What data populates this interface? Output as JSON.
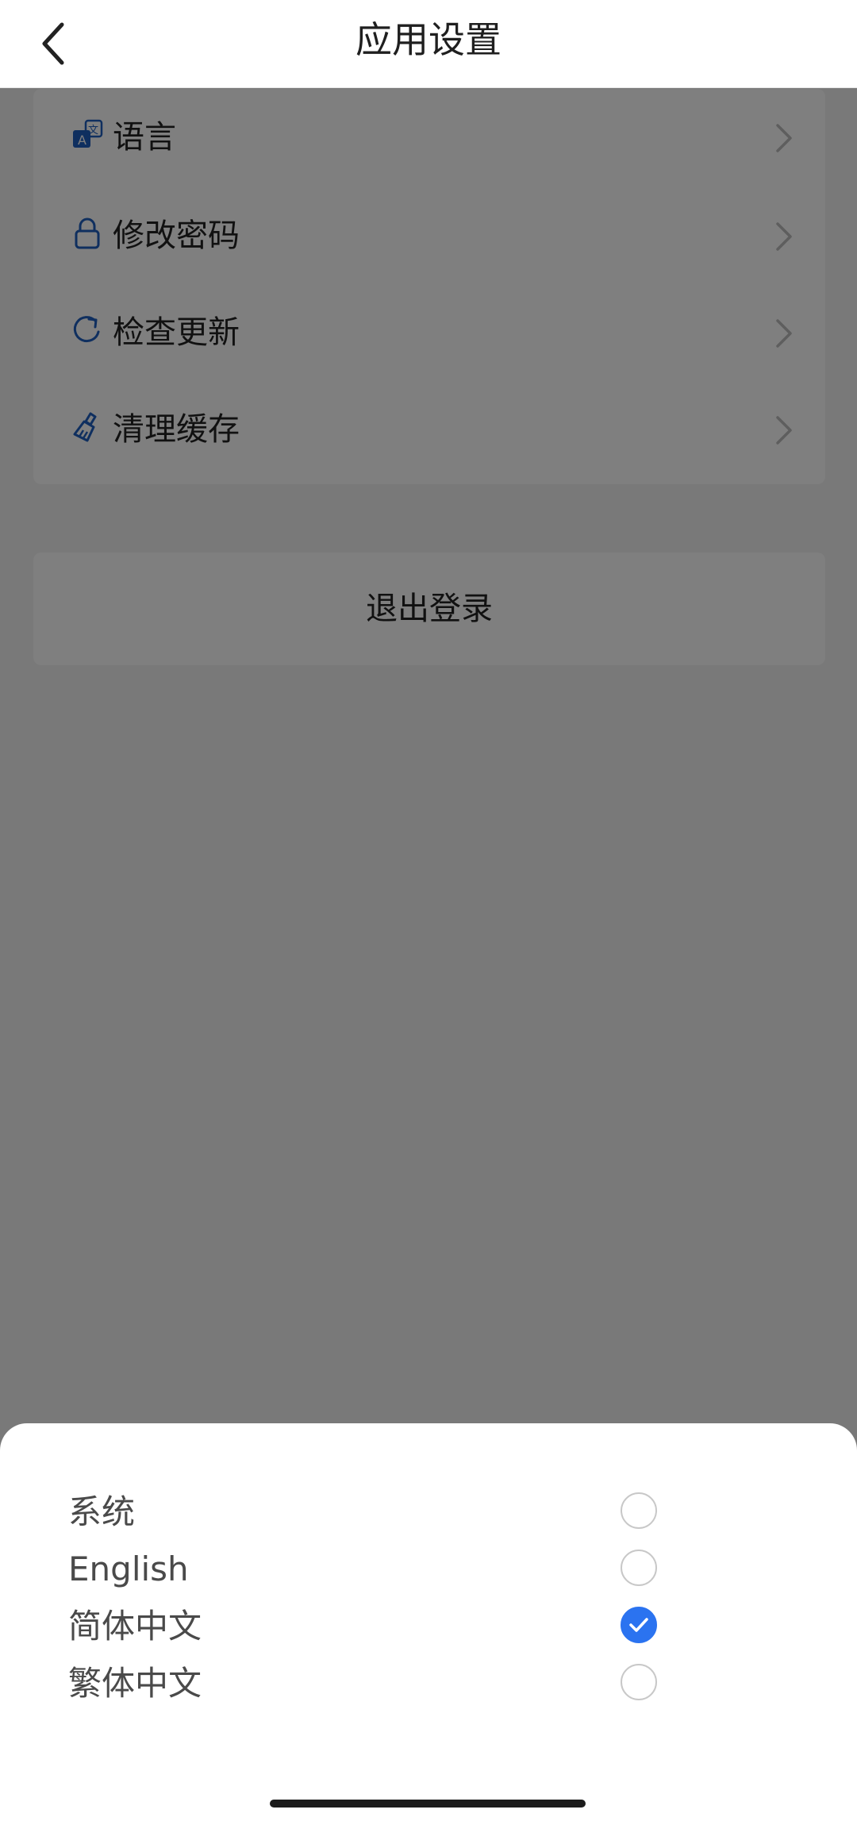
{
  "header": {
    "title": "应用设置",
    "back_icon": "chevron-left-icon"
  },
  "settings": {
    "items": [
      {
        "label": "语言",
        "icon": "translate-icon"
      },
      {
        "label": "修改密码",
        "icon": "lock-icon"
      },
      {
        "label": "检查更新",
        "icon": "refresh-icon"
      },
      {
        "label": "清理缓存",
        "icon": "brush-icon"
      }
    ],
    "chevron_icon": "chevron-right-icon"
  },
  "logout": {
    "label": "退出登录"
  },
  "language_sheet": {
    "options": [
      {
        "label": "系统",
        "selected": false
      },
      {
        "label": "English",
        "selected": false
      },
      {
        "label": "简体中文",
        "selected": true
      },
      {
        "label": "繁体中文",
        "selected": false
      }
    ]
  },
  "colors": {
    "accent": "#2b73f0",
    "icon_blue": "#1f5fbf",
    "overlay": "rgba(0,0,0,0.5)"
  }
}
